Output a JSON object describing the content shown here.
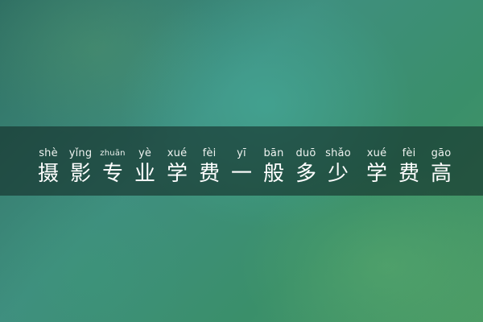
{
  "title": {
    "chars": [
      {
        "pinyin": "shè",
        "hanzi": "摄"
      },
      {
        "pinyin": "yǐng",
        "hanzi": "影"
      },
      {
        "pinyin": "zhuān",
        "hanzi": "专"
      },
      {
        "pinyin": "yè",
        "hanzi": "业"
      },
      {
        "pinyin": "xué",
        "hanzi": "学"
      },
      {
        "pinyin": "fèi",
        "hanzi": "费"
      },
      {
        "pinyin": "yī",
        "hanzi": "一"
      },
      {
        "pinyin": "bān",
        "hanzi": "般"
      },
      {
        "pinyin": "duō",
        "hanzi": "多"
      },
      {
        "pinyin": "shǎo",
        "hanzi": "少"
      },
      {
        "pinyin": "xué",
        "hanzi": "学"
      },
      {
        "pinyin": "fèi",
        "hanzi": "费"
      },
      {
        "pinyin": "gāo",
        "hanzi": "高"
      }
    ]
  }
}
